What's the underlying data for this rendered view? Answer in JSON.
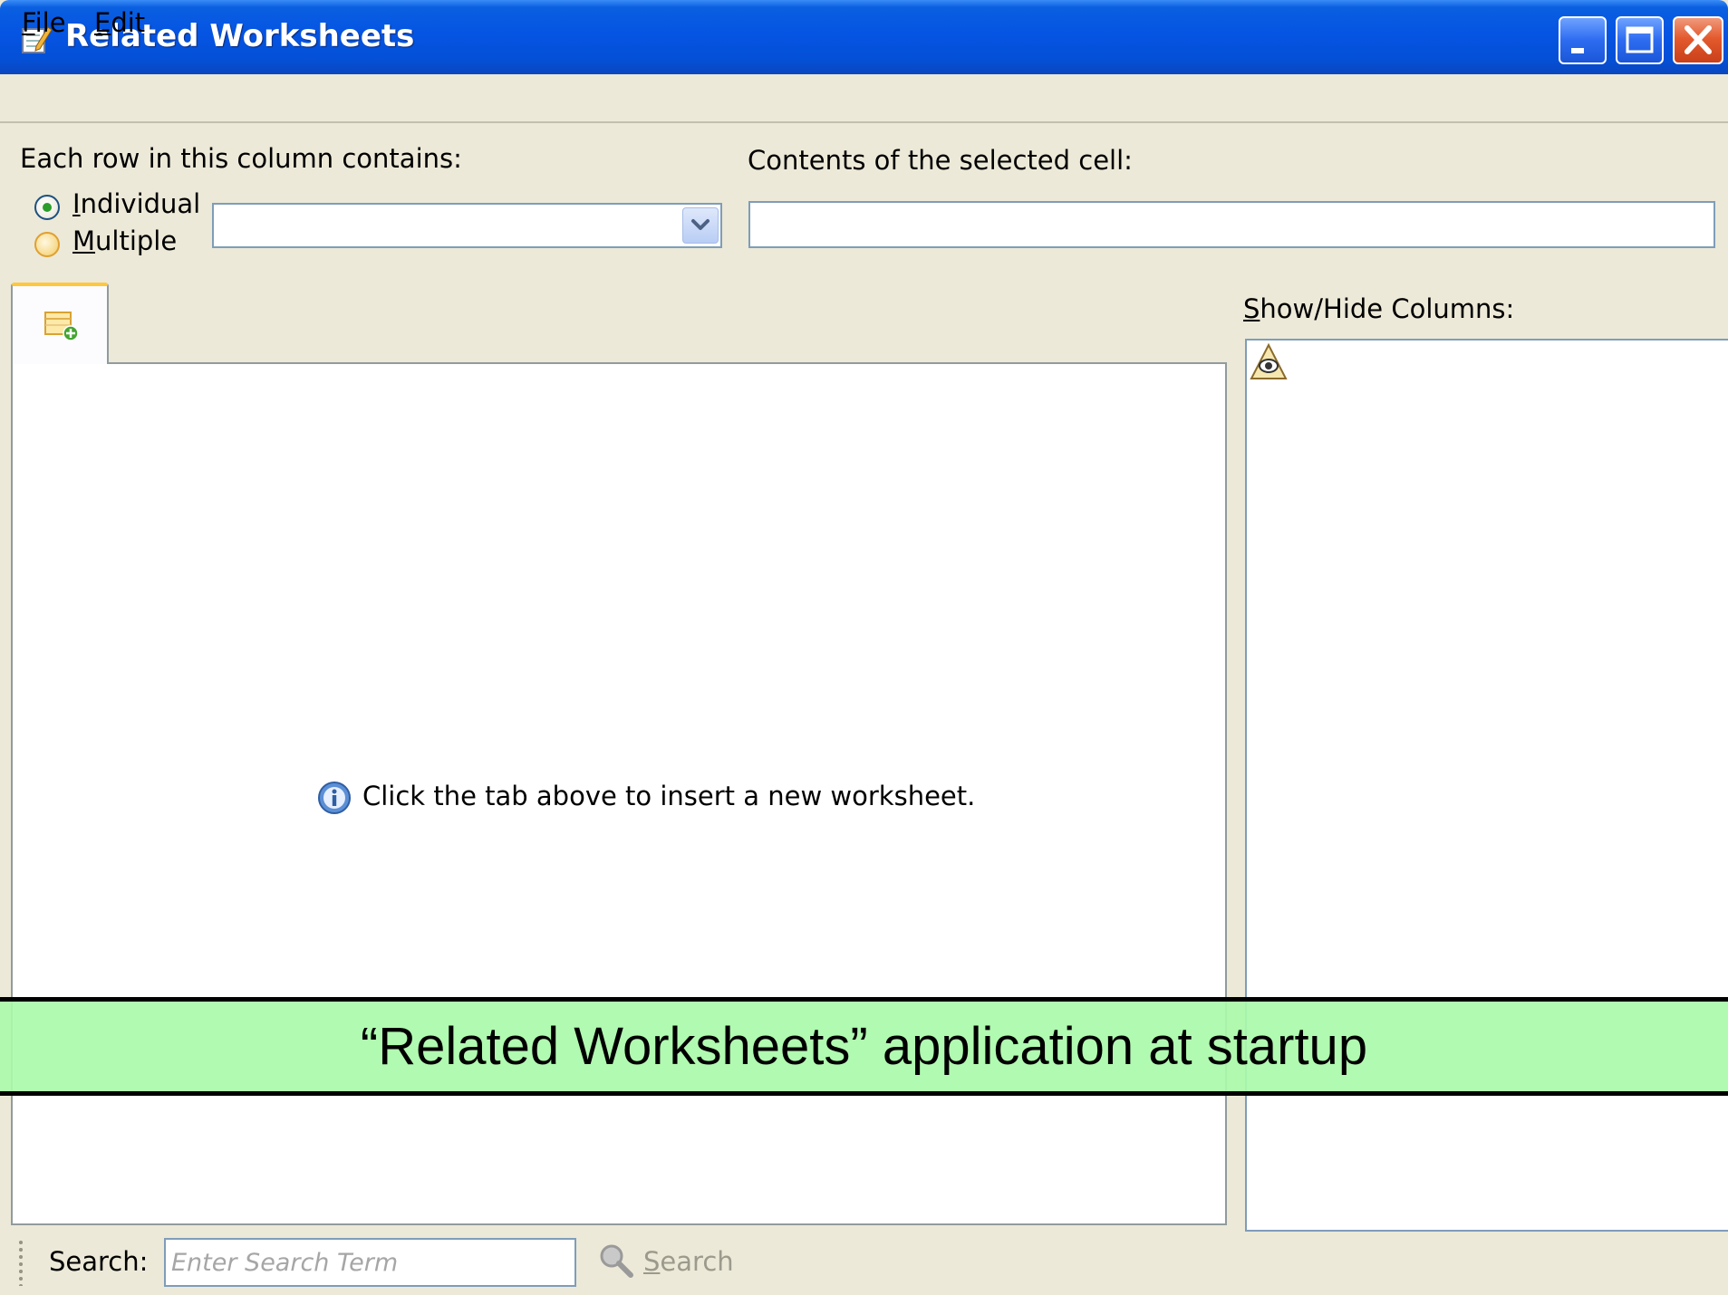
{
  "window": {
    "title": "Related Worksheets",
    "controls": {
      "minimize": "minimize-icon",
      "maximize": "maximize-icon",
      "close": "close-icon"
    }
  },
  "menu": {
    "file": {
      "mnemonic": "F",
      "rest": "ile"
    },
    "edit": {
      "mnemonic": "E",
      "rest": "dit"
    }
  },
  "column_settings": {
    "label": "Each row in this column contains:",
    "options": [
      {
        "mnemonic": "I",
        "rest": "ndividual",
        "selected": true
      },
      {
        "mnemonic": "M",
        "rest": "ultiple",
        "selected": false
      }
    ],
    "combo_value": ""
  },
  "cell": {
    "label": "Contents of the selected cell:",
    "value": ""
  },
  "worksheet": {
    "tab_icon": "new-worksheet-icon",
    "hint": "Click the tab above to insert a new worksheet.",
    "hint_icon": "info-icon"
  },
  "columns_panel": {
    "label_mnemonic": "S",
    "label_rest": "how/Hide Columns:",
    "icon": "eye-icon"
  },
  "caption": "“Related Worksheets” application at startup",
  "search": {
    "label": "Search:",
    "placeholder": "Enter Search Term",
    "button_mnemonic": "S",
    "button_rest": "earch"
  },
  "colors": {
    "titlebar": "#0554e3",
    "chrome": "#ece9d8",
    "caption_bg": "#aafaaa",
    "selected_radio": "#2a9d2a",
    "tab_accent": "#ffc83c"
  }
}
